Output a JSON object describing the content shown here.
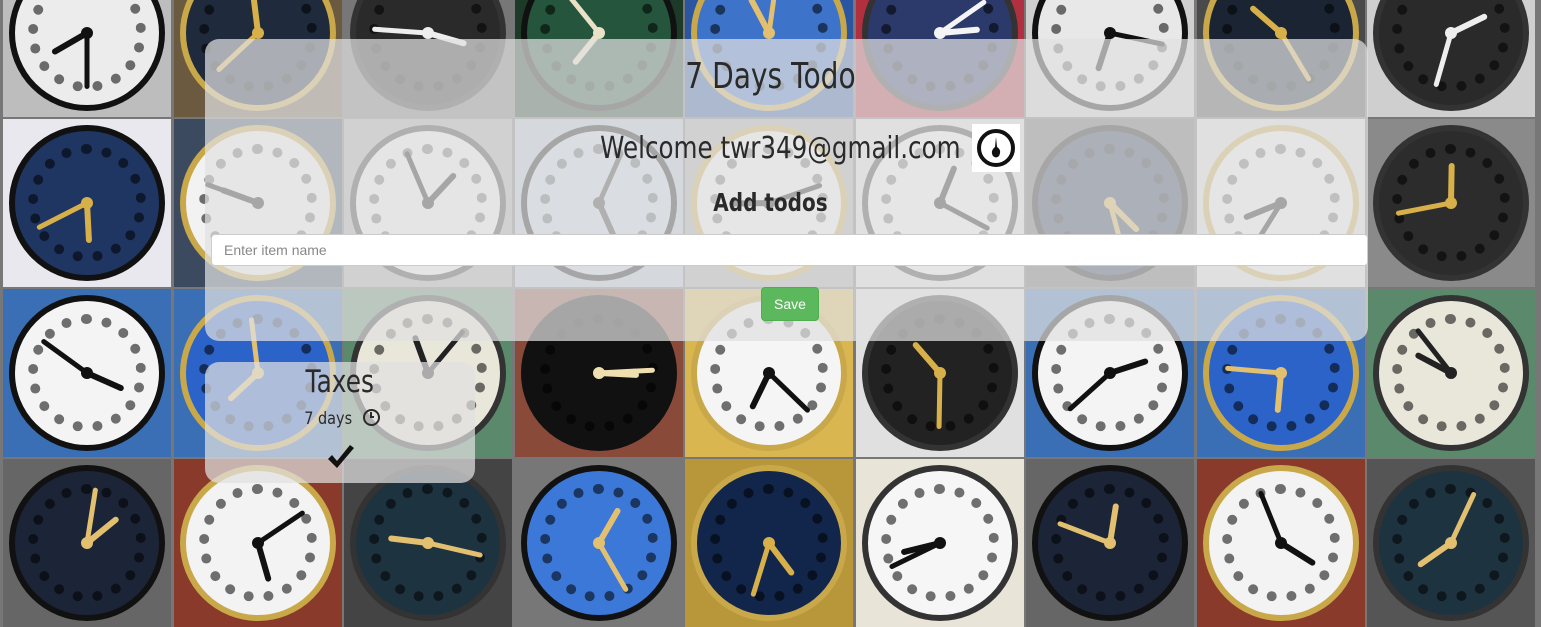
{
  "app": {
    "title": "7 Days Todo",
    "welcome_text": "Welcome twr349@gmail.com",
    "section_heading": "Add todos"
  },
  "form": {
    "item_placeholder": "Enter item name",
    "item_value": "",
    "save_label": "Save"
  },
  "todos": [
    {
      "name": "Taxes",
      "days_label": "7 days",
      "icon": "clock-icon",
      "action_icon": "checkmark-icon"
    }
  ],
  "colors": {
    "save_button": "#5cb85c",
    "panel_overlay": "rgba(225,225,225,0.72)",
    "text": "#2a2a2a"
  }
}
